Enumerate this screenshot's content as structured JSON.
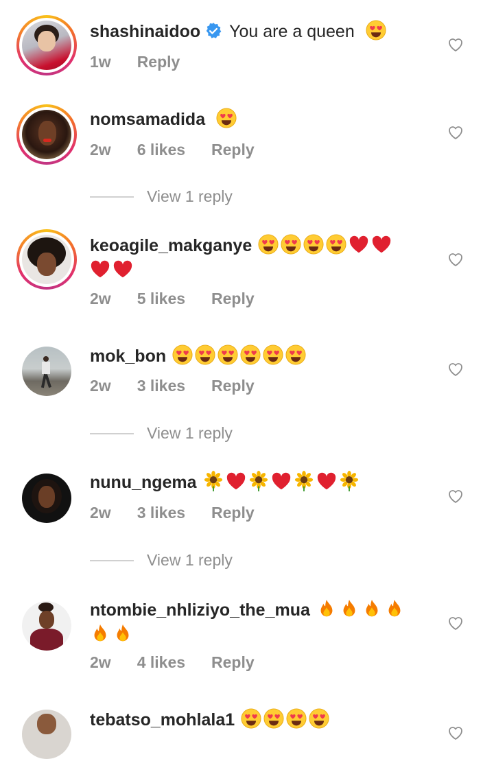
{
  "comments": [
    {
      "username": "shashinaidoo",
      "verified": true,
      "text": "You are a queen",
      "emojis": [
        "heart-eyes"
      ],
      "time": "1w",
      "likes": "",
      "reply": "Reply"
    },
    {
      "username": "nomsamadida",
      "text": "",
      "emojis": [
        "heart-eyes"
      ],
      "time": "2w",
      "likes": "6 likes",
      "reply": "Reply",
      "view_replies": "View 1 reply"
    },
    {
      "username": "keoagile_makganye",
      "text": "",
      "emojis": [
        "heart-eyes",
        "heart-eyes",
        "heart-eyes",
        "heart-eyes",
        "red-heart",
        "red-heart",
        "red-heart",
        "red-heart"
      ],
      "time": "2w",
      "likes": "5 likes",
      "reply": "Reply"
    },
    {
      "username": "mok_bon",
      "text": "",
      "emojis": [
        "heart-eyes",
        "heart-eyes",
        "heart-eyes",
        "heart-eyes",
        "heart-eyes",
        "heart-eyes"
      ],
      "time": "2w",
      "likes": "3 likes",
      "reply": "Reply",
      "view_replies": "View 1 reply"
    },
    {
      "username": "nunu_ngema",
      "text": "",
      "emojis": [
        "sunflower",
        "red-heart",
        "sunflower",
        "red-heart",
        "sunflower",
        "red-heart",
        "sunflower"
      ],
      "time": "2w",
      "likes": "3 likes",
      "reply": "Reply",
      "view_replies": "View 1 reply"
    },
    {
      "username": "ntombie_nhliziyo_the_mua",
      "text": "",
      "emojis": [
        "fire",
        "fire",
        "fire",
        "fire",
        "fire",
        "fire"
      ],
      "time": "2w",
      "likes": "4 likes",
      "reply": "Reply"
    },
    {
      "username": "tebatso_mohlala1",
      "text": "",
      "emojis": [
        "heart-eyes",
        "heart-eyes",
        "heart-eyes",
        "heart-eyes"
      ],
      "time": "",
      "likes": "",
      "reply": ""
    }
  ],
  "colors": {
    "username": "#262626",
    "meta": "#8e8e8e",
    "verified": "#3897f0",
    "red_heart": "#e0202f"
  }
}
